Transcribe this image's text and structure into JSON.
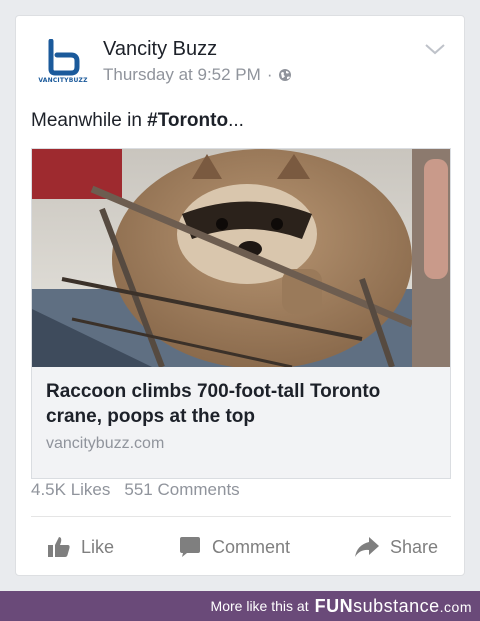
{
  "post": {
    "page_name": "Vancity Buzz",
    "logo_text": "VANCITYBUZZ",
    "timestamp": "Thursday at 9:52 PM",
    "separator": "·",
    "privacy_icon": "globe-icon",
    "menu_icon": "chevron-down-icon",
    "message_prefix": "Meanwhile in ",
    "message_hashtag": "#Toronto",
    "message_suffix": "..."
  },
  "link": {
    "image_alt": "raccoon-on-crane-photo",
    "title": "Raccoon climbs 700-foot-tall Toronto crane, poops at the top",
    "domain": "vancitybuzz.com"
  },
  "stats": {
    "likes": "4.5K Likes",
    "comments": "551 Comments"
  },
  "actions": {
    "like": "Like",
    "comment": "Comment",
    "share": "Share"
  },
  "footer": {
    "prefix": "More like this at",
    "brand_bold": "FUN",
    "brand_light": "substance",
    "brand_tld": ".com"
  },
  "colors": {
    "brand_blue": "#1b5a9b",
    "meta_gray": "#90949c",
    "footer_purple": "#6a4a79"
  }
}
